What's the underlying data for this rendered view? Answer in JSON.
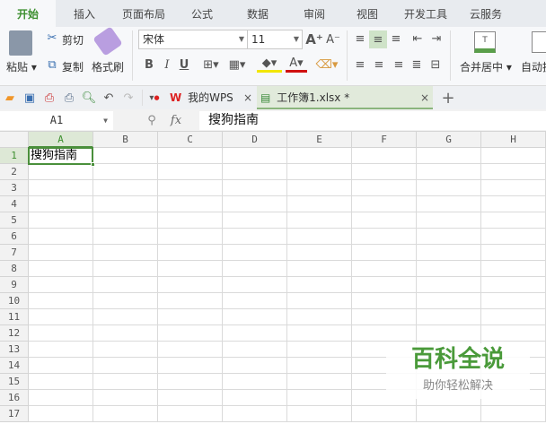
{
  "menu_tabs": [
    "开始",
    "插入",
    "页面布局",
    "公式",
    "数据",
    "审阅",
    "视图",
    "开发工具",
    "云服务"
  ],
  "active_tab": "开始",
  "ribbon": {
    "paste": "粘贴",
    "cut": "剪切",
    "copy": "复制",
    "format_painter": "格式刷",
    "font_name": "宋体",
    "font_size": "11",
    "bold": "B",
    "italic": "I",
    "underline": "U",
    "merge_center": "合并居中",
    "auto_wrap": "自动换"
  },
  "doc_tabs": [
    {
      "label": "我的WPS",
      "active": false
    },
    {
      "label": "工作簿1.xlsx *",
      "active": true
    }
  ],
  "formula_bar": {
    "name_box": "A1",
    "fx": "fx",
    "content": "搜狗指南"
  },
  "columns": [
    "A",
    "B",
    "C",
    "D",
    "E",
    "F",
    "G",
    "H"
  ],
  "rows": [
    "1",
    "2",
    "3",
    "4",
    "5",
    "6",
    "7",
    "8",
    "9",
    "10",
    "11",
    "12",
    "13",
    "14",
    "15",
    "16",
    "17"
  ],
  "cells": {
    "A1": "搜狗指南"
  },
  "watermark": {
    "title": "百科全说",
    "subtitle": "助你轻松解决"
  },
  "colors": {
    "accent": "#3d8f2f",
    "selection": "#4a8f3b"
  }
}
